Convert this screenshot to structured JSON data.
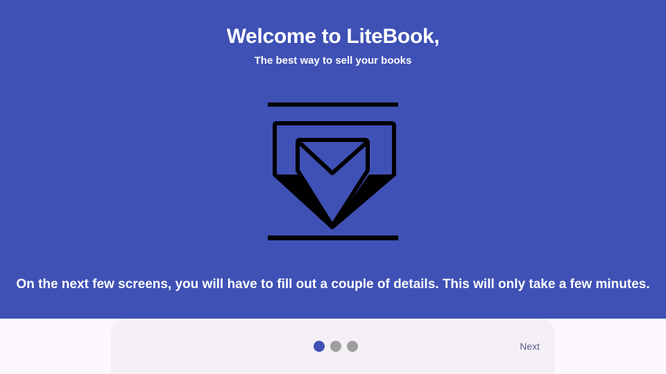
{
  "welcome": {
    "title": "Welcome to LiteBook,",
    "subtitle": "The best way to sell your books",
    "illustration_icon": "mail-inbox-icon",
    "description": "On the next few screens, you will have to fill out a couple of details. This will only take a few minutes."
  },
  "pager": {
    "page_count": 3,
    "current_page": 1,
    "next_label": "Next"
  },
  "colors": {
    "primary": "#3f51b5",
    "on_primary": "#ffffff",
    "inactive_dot": "#9e9e9e",
    "bottom_bar": "#f4f0f6",
    "surface": "#fdf8fd"
  }
}
